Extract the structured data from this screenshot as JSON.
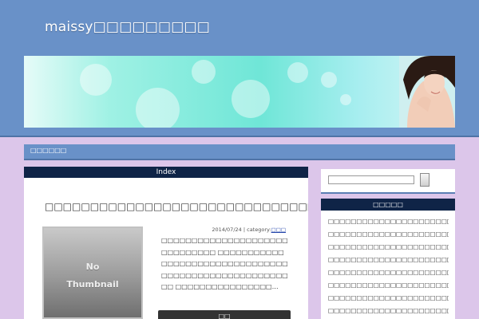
{
  "header": {
    "site_title": "maissy□□□□□□□□□"
  },
  "nav": {
    "items": [
      "□□□□□□"
    ]
  },
  "main": {
    "index_label": "Index",
    "post": {
      "title": "□□□□□□□□□□□□□□□□□□□□□□□□□□□□□□",
      "date": "2014/07/24",
      "category_prefix": "| category:",
      "category": "□□□",
      "thumbnail_text": "No\nThumbnail",
      "excerpt": "□□□□□□□□□□□□□□□□□□□□□□□□□□□□□□ □□□□□□□□□□□□□□□□□□□□□□□□□□□□□□□□□□□□□□□□□□□□□□□□□□□□□□□ □□□□□□□□□□□□□□□□…",
      "more_label": "□□"
    }
  },
  "sidebar": {
    "search": {
      "placeholder": ""
    },
    "widget": {
      "title": "□□□□□",
      "items": [
        "□□□□□□□□□□□□□□□□□□□□□□□□□□□□□",
        "□□□□□□□□□□□□□□□□□□□□□□□□□□",
        "□□□□□□□□□□□□□□□□□□□□□□□□□□□□□",
        "□□□□□□□□□□□□□□□□□□□□□□□□□□□□□",
        "□□□□□□□□□□□□□□□□□□□□□□□□□□□□",
        "□□□□□□□□□□□□□□□□□□□□□□□□□□□□□□",
        "□□□□□□□□□□□□□□□□□□□□□□□□□□□□□",
        "□□□□□□□□□□□□□□□□□□□□□□□□□□□"
      ]
    }
  },
  "colors": {
    "header_blue": "#6991c8",
    "dark_navy": "#0f2447",
    "page_lilac": "#dcc6ea"
  }
}
